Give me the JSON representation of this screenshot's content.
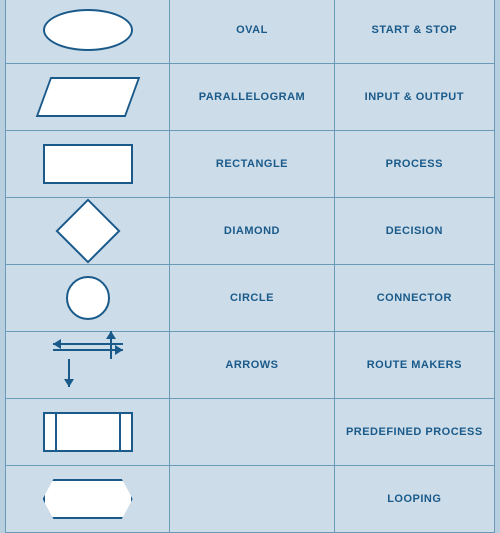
{
  "table": {
    "rows": [
      {
        "id": "oval",
        "shape_name": "OVAL",
        "use_label": "START & STOP"
      },
      {
        "id": "parallelogram",
        "shape_name": "PARALLELOGRAM",
        "use_label": "INPUT & OUTPUT"
      },
      {
        "id": "rectangle",
        "shape_name": "RECTANGLE",
        "use_label": "PROCESS"
      },
      {
        "id": "diamond",
        "shape_name": "DIAMOND",
        "use_label": "DECISION"
      },
      {
        "id": "circle",
        "shape_name": "CIRCLE",
        "use_label": "CONNECTOR"
      },
      {
        "id": "arrows",
        "shape_name": "ARROWS",
        "use_label": "ROUTE MAKERS"
      },
      {
        "id": "predefined",
        "shape_name": "",
        "use_label": "PREDEFINED  PROCESS"
      },
      {
        "id": "looping",
        "shape_name": "",
        "use_label": "LOOPING"
      }
    ]
  }
}
